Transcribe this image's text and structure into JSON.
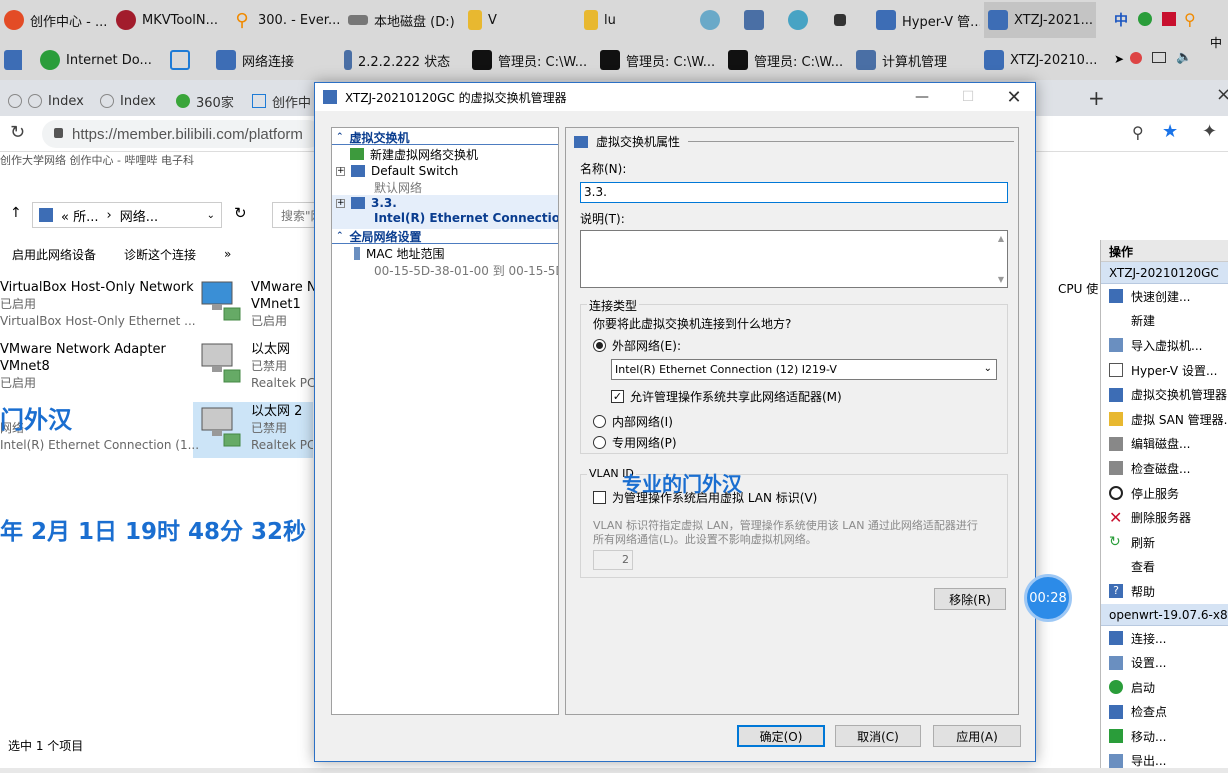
{
  "taskbar_row1": [
    {
      "label": "创作中心 - ...",
      "color": "#e34c26"
    },
    {
      "label": "MKVToolN...",
      "color": "#a21c2c"
    },
    {
      "label": "300. - Ever...",
      "color": "#f08a00"
    },
    {
      "label": "本地磁盘 (D:)",
      "color": "#555555"
    },
    {
      "label": "V",
      "color": "#e8b830"
    },
    {
      "label": "lu",
      "color": "#e8b830"
    },
    {
      "label": "Hyper-V 管...",
      "color": "#3d6db5"
    },
    {
      "label": "XTZJ-2021...",
      "color": "#3d6db5"
    }
  ],
  "taskbar_row2": [
    {
      "label": "Internet Do...",
      "color": "#2a9d3a"
    },
    {
      "label": "网络连接",
      "color": "#3d6db5"
    },
    {
      "label": "2.2.2.222 状态",
      "color": "#4a6fa5"
    },
    {
      "label": "管理员: C:\\W...",
      "color": "#111111"
    },
    {
      "label": "管理员: C:\\W...",
      "color": "#111111"
    },
    {
      "label": "管理员: C:\\W...",
      "color": "#111111"
    },
    {
      "label": "计算机管理",
      "color": "#4a6fa5"
    },
    {
      "label": "XTZJ-20210...",
      "color": "#3d6db5"
    }
  ],
  "tray": {
    "ime": "中",
    "ime2": "中"
  },
  "browser": {
    "tabs": [
      "Index",
      "Index",
      "360家",
      "创作中"
    ],
    "url": "https://member.bilibili.com/platform",
    "bookmarks": "创作大学网络    创作中心 - 哔哩哔    电子科"
  },
  "explorer": {
    "path_a": "«  所...",
    "path_b": "网络...",
    "search_placeholder": "搜索\"网",
    "cmd_enable": "启用此网络设备",
    "cmd_diag": "诊断这个连接",
    "cmd_more": "»",
    "items": [
      {
        "t1": "VirtualBox Host-Only Network",
        "t2": "已启用",
        "t3": "VirtualBox Host-Only Ethernet ..."
      },
      {
        "t1": "VMware N",
        "t2": "VMnet1",
        "t3": "已启用"
      },
      {
        "t1": "VMware Network Adapter",
        "t2": "VMnet8",
        "t3": "已启用"
      },
      {
        "t1": "以太网",
        "t2": "已禁用",
        "t3": "Realtek PC"
      },
      {
        "t1": "网络",
        "t2": "Intel(R) Ethernet Connection (1..."
      },
      {
        "t1": "以太网 2",
        "t2": "已禁用",
        "t3": "Realtek PC"
      }
    ],
    "status": "选中 1 个项目"
  },
  "overlay": {
    "watermark1": "门外汉",
    "date": "年 2月 1日 19时 48分 32秒",
    "watermark2": "专业的门外汉"
  },
  "mid_panel": {
    "cpu": "CPU 使"
  },
  "actions": {
    "header": "操作",
    "group1": "XTZJ-20210120GC",
    "items1": [
      "快速创建...",
      "新建",
      "导入虚拟机...",
      "Hyper-V 设置...",
      "虚拟交换机管理器...",
      "虚拟 SAN 管理器...",
      "编辑磁盘...",
      "检查磁盘...",
      "停止服务",
      "删除服务器",
      "刷新",
      "查看",
      "帮助"
    ],
    "group2": "openwrt-19.07.6-x86",
    "items2": [
      "连接...",
      "设置...",
      "启动",
      "检查点",
      "移动...",
      "导出..."
    ]
  },
  "dialog": {
    "title": "XTZJ-20210120GC 的虚拟交换机管理器",
    "tree": {
      "section1": "虚拟交换机",
      "new_switch": "新建虚拟网络交换机",
      "default_switch": "Default Switch",
      "default_sub": "默认网络",
      "switch_name": "3.3.",
      "switch_sub": "Intel(R) Ethernet Connection ...",
      "section2": "全局网络设置",
      "mac": "MAC 地址范围",
      "mac_sub": "00-15-5D-38-01-00 到 00-15-5D-3..."
    },
    "props": {
      "header": "虚拟交换机属性",
      "name_label": "名称(N):",
      "name_value": "3.3.",
      "desc_label": "说明(T):",
      "conn_group": "连接类型",
      "conn_question": "你要将此虚拟交换机连接到什么地方?",
      "external": "外部网络(E):",
      "adapter": "Intel(R) Ethernet Connection (12) I219-V",
      "allow_share": "允许管理操作系统共享此网络适配器(M)",
      "internal": "内部网络(I)",
      "private": "专用网络(P)",
      "vlan_group": "VLAN ID",
      "vlan_check": "为管理操作系统启用虚拟 LAN 标识(V)",
      "vlan_desc1": "VLAN 标识符指定虚拟 LAN，管理操作系统使用该 LAN 通过此网络适配器进行",
      "vlan_desc2": "所有网络通信(L)。此设置不影响虚拟机网络。",
      "vlan_value": "2",
      "remove": "移除(R)"
    },
    "buttons": {
      "ok": "确定(O)",
      "cancel": "取消(C)",
      "apply": "应用(A)"
    }
  },
  "timer": "00:28"
}
